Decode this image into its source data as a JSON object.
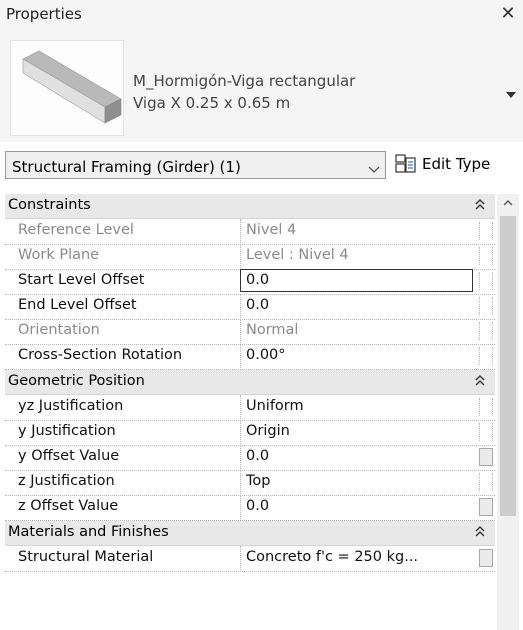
{
  "panel": {
    "title": "Properties",
    "close_symbol": "✕"
  },
  "type_selector": {
    "family": "M_Hormigón-Viga rectangular",
    "type": "Viga X 0.25 x 0.65 m",
    "thumbnail_icon": "beam-thumbnail-icon",
    "dropdown_icon": "triangle-down-icon"
  },
  "instance_filter": {
    "label": "Structural Framing (Girder) (1)",
    "chevron_icon": "chevron-down-icon"
  },
  "edit_type": {
    "label": "Edit Type",
    "icon": "edit-type-icon"
  },
  "groups": {
    "constraints": {
      "label": "Constraints",
      "rows": [
        {
          "name": "Reference Level",
          "value": "Nivel 4",
          "readonly": true
        },
        {
          "name": "Work Plane",
          "value": "Level : Nivel 4",
          "readonly": true
        },
        {
          "name": "Start Level Offset",
          "value": "0.0",
          "readonly": false,
          "editing": true
        },
        {
          "name": "End Level Offset",
          "value": "0.0",
          "readonly": false
        },
        {
          "name": "Orientation",
          "value": "Normal",
          "readonly": true
        },
        {
          "name": "Cross-Section Rotation",
          "value": "0.00°",
          "readonly": false
        }
      ]
    },
    "geometric_position": {
      "label": "Geometric Position",
      "rows": [
        {
          "name": "yz Justification",
          "value": "Uniform",
          "readonly": false
        },
        {
          "name": "y Justification",
          "value": "Origin",
          "readonly": false
        },
        {
          "name": "y Offset Value",
          "value": "0.0",
          "readonly": false,
          "button": true
        },
        {
          "name": "z Justification",
          "value": "Top",
          "readonly": false
        },
        {
          "name": "z Offset Value",
          "value": "0.0",
          "readonly": false,
          "button": true
        }
      ]
    },
    "materials": {
      "label": "Materials and Finishes",
      "rows": [
        {
          "name": "Structural Material",
          "value": "Concreto f'c = 250 kg...",
          "readonly": false,
          "button": true
        }
      ]
    }
  },
  "colors": {
    "panel_bg": "#f5f5f5",
    "group_header_bg": "#e8e8e8",
    "readonly_text": "#8a8a8a",
    "editor_border": "#333333"
  }
}
